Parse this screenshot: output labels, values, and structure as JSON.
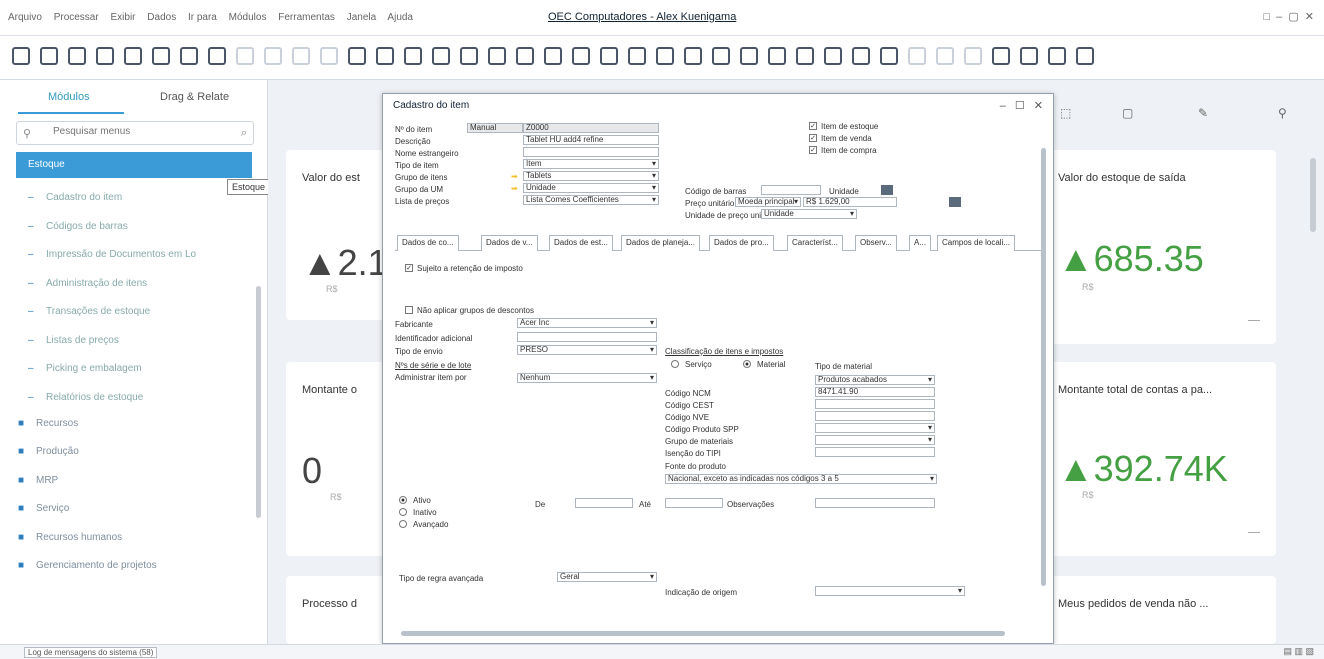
{
  "menubar": {
    "items": [
      "Arquivo",
      "Processar",
      "Exibir",
      "Dados",
      "Ir para",
      "Módulos",
      "Ferramentas",
      "Janela",
      "Ajuda"
    ],
    "title": "OEC Computadores - Alex Kuenigama",
    "controls": "□ – ▢ ✕"
  },
  "sidebar": {
    "tab_modules": "Módulos",
    "tab_dragdrop": "Drag & Relate",
    "search_placeholder": "Pesquisar menus",
    "selected": "Estoque",
    "tooltip": "Estoque",
    "items": [
      {
        "label": "Cadastro do item",
        "type": "sub"
      },
      {
        "label": "Códigos de barras",
        "type": "sub"
      },
      {
        "label": "Impressão de Documentos em Lo",
        "type": "sub"
      },
      {
        "label": "Administração de itens",
        "type": "sub"
      },
      {
        "label": "Transações de estoque",
        "type": "sub"
      },
      {
        "label": "Listas de preços",
        "type": "sub"
      },
      {
        "label": "Picking e embalagem",
        "type": "sub"
      },
      {
        "label": "Relatórios de estoque",
        "type": "sub"
      },
      {
        "label": "Recursos",
        "type": "top",
        "icon": "people-icon"
      },
      {
        "label": "Produção",
        "type": "top",
        "icon": "gear-icon"
      },
      {
        "label": "MRP",
        "type": "top",
        "icon": "chart-icon"
      },
      {
        "label": "Serviço",
        "type": "top",
        "icon": "wrench-icon"
      },
      {
        "label": "Recursos humanos",
        "type": "top",
        "icon": "person-icon"
      },
      {
        "label": "Gerenciamento de projetos",
        "type": "top",
        "icon": "folder-icon"
      }
    ]
  },
  "cards": [
    {
      "title": "Valor do est",
      "value": "▲2.1",
      "currency": "R$"
    },
    {
      "title": "Valor do estoque de saída",
      "value": "▲685.35",
      "currency": "R$"
    },
    {
      "title": "Montante o",
      "value": "",
      "currency": ""
    },
    {
      "title": "Montante total de contas a pa...",
      "value": "▲392.74K",
      "currency": "R$"
    },
    {
      "title": "",
      "value": "0",
      "currency": "R$"
    },
    {
      "title": "Processo d",
      "value": "",
      "currency": ""
    },
    {
      "title": "Meus pedidos de venda não ...",
      "value": "",
      "currency": ""
    }
  ],
  "dialog": {
    "title": "Cadastro do item",
    "controls": "– ☐ ✕",
    "fields": {
      "item_no_label": "Nº do item",
      "item_no_mode": "Manual",
      "item_no_value": "Z0000",
      "desc_label": "Descrição",
      "desc_value": "Tablet HU add4 refine",
      "foreign_label": "Nome estrangeiro",
      "type_label": "Tipo de item",
      "type_value": "Item",
      "group_label": "Grupo de itens",
      "group_value": "Tablets",
      "um_group_label": "Grupo da UM",
      "um_group_value": "Unidade",
      "price_list_label": "Lista de preços",
      "price_list_value": "Lista Comes Coefficientes"
    },
    "checks": {
      "stock": "Item de estoque",
      "sales": "Item de venda",
      "purchase": "Item de compra"
    },
    "barcode": {
      "label": "Código de barras",
      "unit_label": "Unidade",
      "unit_price_label": "Preço unitário",
      "primary": "Moeda principal",
      "price": "R$ 1.629,00",
      "unidade": "Unidade",
      "um_price_label": "Unidade de preço unitário",
      "um_price_value": "Unidade"
    },
    "tabs": [
      "Dados de co...",
      "Dados de v...",
      "Dados de est...",
      "Dados de planeja...",
      "Dados de pro...",
      "Característ...",
      "Observ...",
      "A...",
      "Campos de locali..."
    ],
    "tab_content": {
      "manufacture_chk": "Sujeito a retenção de imposto",
      "nodisc_chk": "Não aplicar grupos de descontos",
      "fabricante_label": "Fabricante",
      "fabricante_value": "Acer Inc",
      "addl_label": "Identificador adicional",
      "ship_label": "Tipo de envio",
      "ship_value": "PRESO",
      "serial_label": "Nºs de série e de lote",
      "manage_label": "Administrar item por",
      "manage_value": "Nenhum",
      "classif_title": "Classificação de itens e impostos",
      "serv_label": "Serviço",
      "mat_label": "Material",
      "mattype_label": "Tipo de material",
      "mattype_value": "Produtos acabados",
      "ncm_label": "Código NCM",
      "ncm_value": "8471.41.90",
      "cest_label": "Código CEST",
      "nve_label": "Código NVE",
      "spp_label": "Código Produto SPP",
      "mgroup_label": "Grupo de materiais",
      "tipi_label": "Isenção do TIPI",
      "origin_label": "Fonte do produto",
      "origin_value": "Nacional, exceto as indicadas nos códigos 3 a 5",
      "active": "Ativo",
      "inactive": "Inativo",
      "advanced": "Avançado",
      "de_label": "De",
      "ate_label": "Até",
      "obs_label": "Observações",
      "plan_label": "Tipo de regra avançada",
      "plan_value": "Geral",
      "origin2_label": "Indicação de origem"
    }
  },
  "statusbar": {
    "text": "Log de mensagens do sistema (58)",
    "icons": "▤ ▥ ▧"
  }
}
